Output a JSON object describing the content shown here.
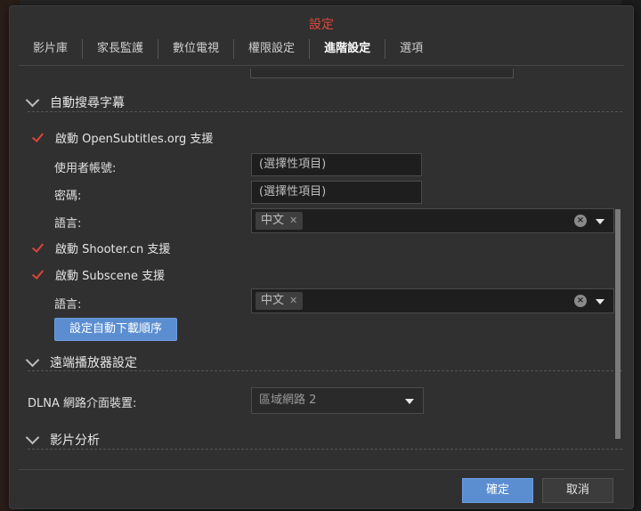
{
  "dialog": {
    "title": "設定"
  },
  "tabs": [
    {
      "label": "影片庫"
    },
    {
      "label": "家長監護"
    },
    {
      "label": "數位電視"
    },
    {
      "label": "權限設定"
    },
    {
      "label": "進階設定",
      "active": true
    },
    {
      "label": "選項"
    }
  ],
  "subtitles": {
    "section_title": "自動搜尋字幕",
    "opensubtitles_label": "啟動 OpenSubtitles.org 支援",
    "opensubtitles_checked": true,
    "username_label": "使用者帳號:",
    "username_placeholder": "(選擇性項目)",
    "password_label": "密碼:",
    "password_placeholder": "(選擇性項目)",
    "language_label": "語言:",
    "language_chip": "中文",
    "shooter_label": "啟動 Shooter.cn 支援",
    "shooter_checked": true,
    "subscene_label": "啟動 Subscene 支援",
    "subscene_checked": true,
    "language2_label": "語言:",
    "language2_chip": "中文",
    "order_button": "設定自動下載順序"
  },
  "remote_player": {
    "section_title": "遠端播放器設定",
    "dlna_label": "DLNA 網路介面裝置:",
    "dlna_value": "區域網路 2"
  },
  "video_analysis": {
    "section_title": "影片分析"
  },
  "footer": {
    "ok_label": "確定",
    "cancel_label": "取消"
  },
  "colors": {
    "accent_blue": "#5b8ed1",
    "title_red": "#e2483a",
    "check_red": "#d9453a"
  }
}
